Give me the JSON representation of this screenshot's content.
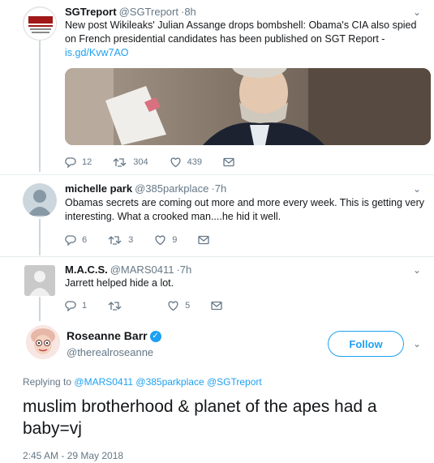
{
  "thread": [
    {
      "name": "SGTreport",
      "handle": "@SGTreport",
      "time": "8h",
      "avatar_text": "SGT REPORT",
      "text": "New post Wikileaks' Julian Assange drops bombshell: Obama's CIA also spied on French presidential candidates has been published on SGT Report -",
      "link": "is.gd/Kvw7AO",
      "replies": "12",
      "retweets": "304",
      "likes": "439"
    },
    {
      "name": "michelle park",
      "handle": "@385parkplace",
      "time": "7h",
      "text": "Obamas secrets are coming out more and more every week. This is getting very interesting.  What a crooked man....he hid it well.",
      "replies": "6",
      "retweets": "3",
      "likes": "9"
    },
    {
      "name": "M.A.C.S.",
      "handle": "@MARS0411",
      "time": "7h",
      "text": "Jarrett helped hide a lot.",
      "replies": "1",
      "retweets": "",
      "likes": "5"
    }
  ],
  "main": {
    "name": "Roseanne Barr",
    "handle": "@therealroseanne",
    "follow_label": "Follow",
    "replying_prefix": "Replying to",
    "replying_to": "@MARS0411 @385parkplace @SGTreport",
    "text": "muslim brotherhood & planet of the apes had a baby=vj",
    "timestamp": "2:45 AM - 29 May 2018"
  },
  "icons": {
    "reply": "reply-icon",
    "retweet": "retweet-icon",
    "like": "heart-icon",
    "dm": "envelope-icon",
    "menu": "chevron-down-icon",
    "verified": "verified-badge-icon"
  },
  "colors": {
    "accent": "#1da1f2",
    "muted": "#657786",
    "text": "#14171a"
  }
}
